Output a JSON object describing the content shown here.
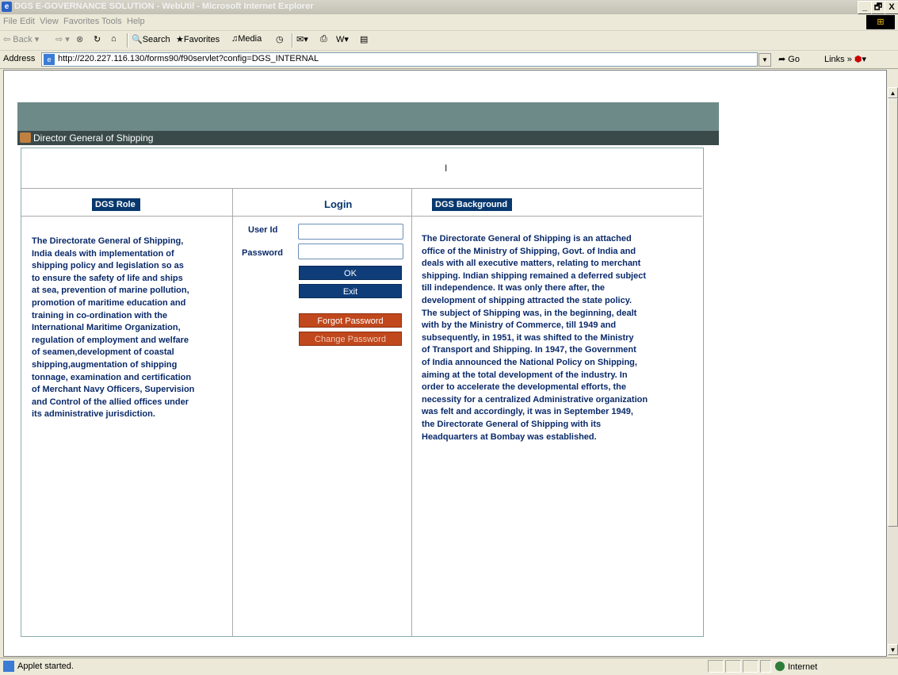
{
  "window": {
    "title": "DGS E-GOVERNANCE SOLUTION - WebUtil - Microsoft Internet Explorer",
    "controls": [
      "_",
      "🗗",
      "X"
    ]
  },
  "menu": {
    "items": [
      "File",
      "Edit",
      "View",
      "Favorites",
      "Tools",
      "Help"
    ]
  },
  "toolbar": {
    "back": "Back",
    "search": "Search",
    "favorites": "Favorites",
    "media": "Media"
  },
  "address": {
    "label": "Address",
    "url": "http://220.227.116.130/forms90/f90servlet?config=DGS_INTERNAL",
    "go": "Go",
    "links": "Links"
  },
  "applet": {
    "title": "Director General of Shipping",
    "cursor_glyph": "I",
    "role": {
      "header": "DGS Role",
      "text": "The Directorate General of Shipping,\nIndia deals with implementation of\nshipping policy and legislation so as\nto ensure the safety of life and ships\nat sea, prevention of marine pollution,\npromotion of maritime education and\ntraining in co-ordination with the\nInternational Maritime Organization,\nregulation of employment and welfare\nof seamen,development of coastal\nshipping,augmentation of shipping\ntonnage, examination and certification\nof Merchant Navy Officers, Supervision\nand Control of the allied offices under\nits administrative jurisdiction."
    },
    "login": {
      "header": "Login",
      "user_id_label": "User Id",
      "password_label": "Password",
      "user_id_value": "",
      "password_value": "",
      "ok_label": "OK",
      "exit_label": "Exit",
      "forgot_label": "Forgot Password",
      "change_label": "Change Password"
    },
    "background": {
      "header": "DGS Background",
      "text": "The Directorate General of Shipping is an attached\noffice of the Ministry of Shipping, Govt. of India and\ndeals with all executive matters, relating to merchant\nshipping. Indian shipping remained a deferred subject\ntill independence. It was only there after, the\ndevelopment of shipping attracted the state policy.\nThe subject of Shipping was, in the beginning, dealt\nwith by the Ministry of Commerce, till 1949 and\nsubsequently, in 1951, it was shifted to the Ministry\nof Transport and Shipping. In 1947, the Government\nof India announced the National Policy on Shipping,\naiming at the total development of the industry. In\norder to accelerate the developmental efforts, the\nnecessity for a centralized Administrative organization\nwas felt and accordingly, it was in September 1949,\nthe Directorate General of Shipping with its\nHeadquarters at Bombay was established."
    }
  },
  "status": {
    "text": "Applet started.",
    "zone": "Internet"
  },
  "colors": {
    "banner": "#6d8a88",
    "titlebar": "#3a4a4a",
    "header_bg": "#08386e",
    "button_blue": "#0e3d7a",
    "button_orange": "#c0481c"
  }
}
